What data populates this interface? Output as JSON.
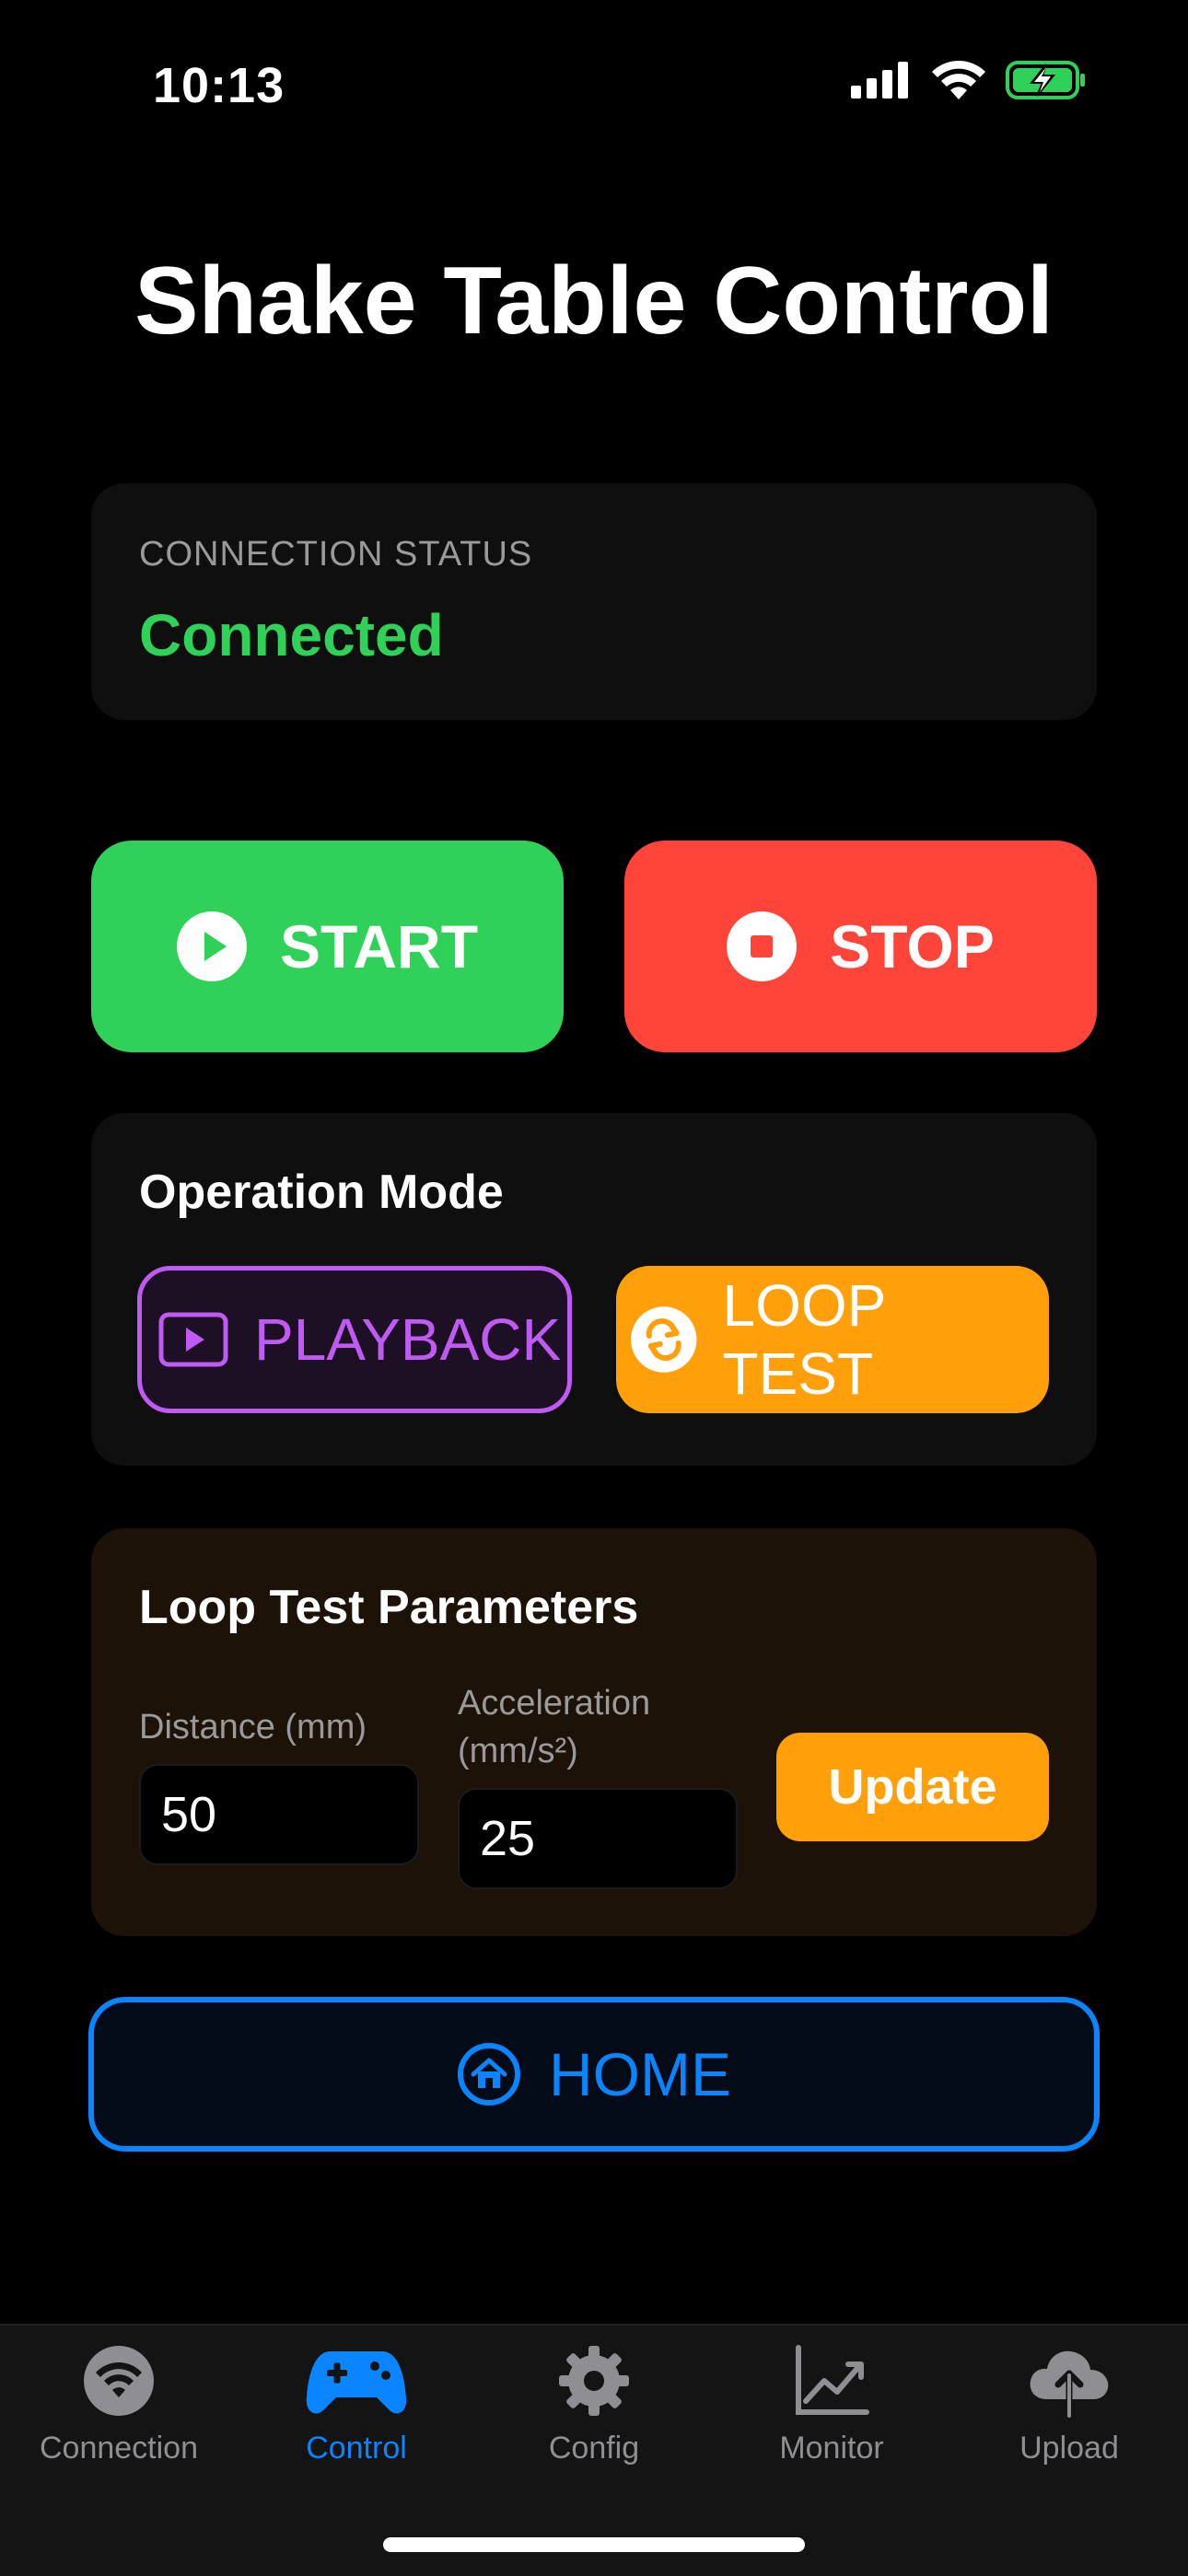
{
  "status_bar": {
    "time": "10:13"
  },
  "title": "Shake Table Control",
  "connection": {
    "label": "CONNECTION STATUS",
    "value": "Connected",
    "status_color": "#30d158"
  },
  "controls": {
    "start_label": "START",
    "stop_label": "STOP"
  },
  "operation_mode": {
    "title": "Operation Mode",
    "playback_label": "PLAYBACK",
    "loop_test_label": "LOOP TEST",
    "selected": "LOOP TEST"
  },
  "loop_params": {
    "title": "Loop Test Parameters",
    "distance_label": "Distance (mm)",
    "distance_value": "50",
    "acceleration_label": "Acceleration (mm/s²)",
    "acceleration_value": "25",
    "update_label": "Update"
  },
  "home": {
    "label": "HOME"
  },
  "tabs": [
    {
      "label": "Connection",
      "icon": "wifi-icon",
      "active": false
    },
    {
      "label": "Control",
      "icon": "gamecontroller-icon",
      "active": true
    },
    {
      "label": "Config",
      "icon": "gear-icon",
      "active": false
    },
    {
      "label": "Monitor",
      "icon": "chart-icon",
      "active": false
    },
    {
      "label": "Upload",
      "icon": "cloud-upload-icon",
      "active": false
    }
  ],
  "colors": {
    "start": "#30d158",
    "stop": "#ff453a",
    "playback": "#bf5af2",
    "loop": "#ff9f0a",
    "accent": "#0a84ff",
    "inactive_tab": "#8e8e93"
  }
}
